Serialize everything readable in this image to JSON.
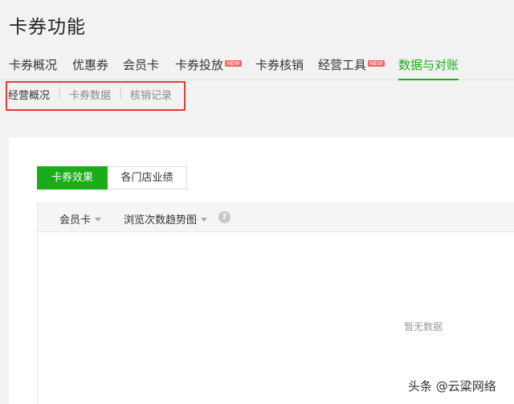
{
  "page": {
    "title": "卡券功能"
  },
  "tabs": [
    {
      "label": "卡券概况"
    },
    {
      "label": "优惠券"
    },
    {
      "label": "会员卡"
    },
    {
      "label": "卡券投放",
      "badge": "NEW"
    },
    {
      "label": "卡券核销"
    },
    {
      "label": "经营工具",
      "badge": "NEW"
    },
    {
      "label": "数据与对账",
      "active": true
    }
  ],
  "subnav": {
    "items": [
      {
        "label": "经营概况",
        "active": true
      },
      {
        "label": "卡券数据"
      },
      {
        "label": "核销记录"
      }
    ],
    "separator": "|"
  },
  "segment": {
    "items": [
      "卡券效果",
      "各门店业绩"
    ]
  },
  "filters": {
    "card_type": "会员卡",
    "chart_type": "浏览次数趋势图",
    "help": "?"
  },
  "empty_text": "暂无数据",
  "watermark": "头条 @云粱网络",
  "colors": {
    "accent": "#1aad19",
    "highlight": "#e03b3b",
    "badge": "#f76260"
  }
}
